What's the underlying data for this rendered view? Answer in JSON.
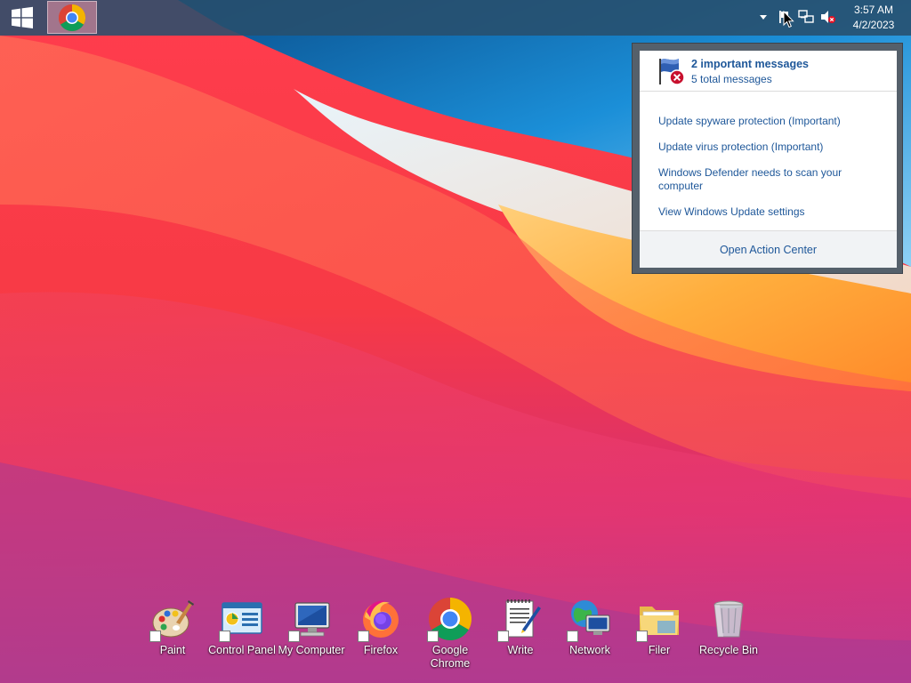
{
  "taskbar": {
    "start_label": "Start",
    "pinned": [
      {
        "name": "Google Chrome",
        "icon": "chrome-icon",
        "active": true
      }
    ],
    "tray": {
      "icons": [
        "chevron-up-icon",
        "action-center-flag-icon",
        "network-icon",
        "volume-muted-icon"
      ],
      "time": "3:57 AM",
      "date": "4/2/2023"
    }
  },
  "action_center_popup": {
    "title": "2 important messages",
    "subtitle": "5 total messages",
    "messages": [
      {
        "text": "Update spyware protection (Important)"
      },
      {
        "text": "Update virus protection (Important)"
      },
      {
        "text": "Windows Defender needs to scan your computer"
      },
      {
        "text": "View Windows Update settings"
      }
    ],
    "footer_link": "Open Action Center"
  },
  "desktop_icons": [
    {
      "label": "Paint",
      "icon": "paint-icon"
    },
    {
      "label": "Control Panel",
      "icon": "control-panel-icon"
    },
    {
      "label": "My Computer",
      "icon": "my-computer-icon"
    },
    {
      "label": "Firefox",
      "icon": "firefox-icon"
    },
    {
      "label": "Google Chrome",
      "icon": "chrome-icon"
    },
    {
      "label": "Write",
      "icon": "write-icon"
    },
    {
      "label": "Network",
      "icon": "network-icon"
    },
    {
      "label": "Filer",
      "icon": "folder-icon"
    },
    {
      "label": "Recycle Bin",
      "icon": "recycle-bin-icon"
    }
  ],
  "colors": {
    "taskbar": "#284e6c",
    "link_blue": "#1e5799",
    "wallpaper_red": "#f0373f",
    "wallpaper_orange": "#ffa637",
    "wallpaper_blue": "#1a8fd6",
    "wallpaper_magenta": "#c8357a"
  }
}
